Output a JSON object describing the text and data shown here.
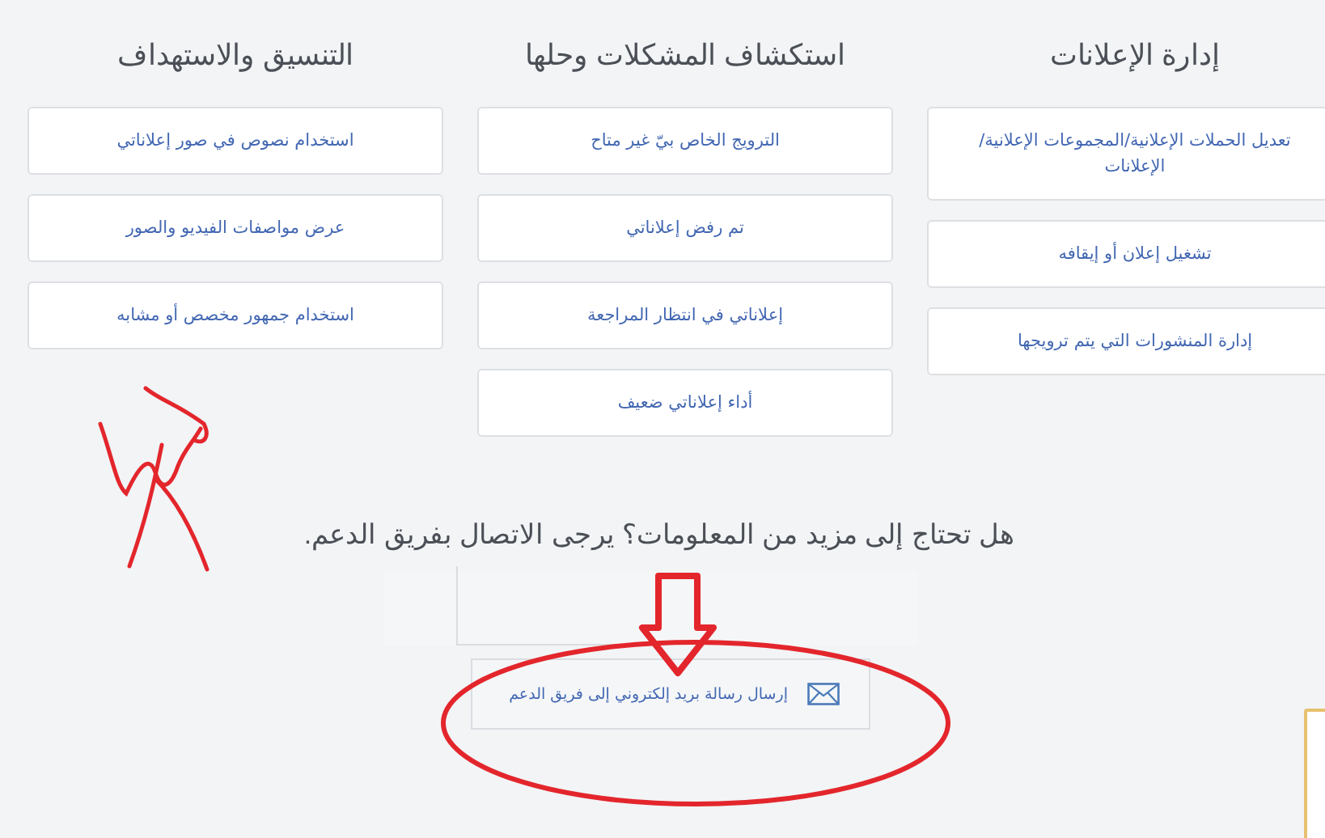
{
  "columns": [
    {
      "heading": "إدارة الإعلانات",
      "items": [
        "تعديل الحملات الإعلانية/المجموعات الإعلانية/ الإعلانات",
        "تشغيل إعلان أو إيقافه",
        "إدارة المنشورات التي يتم ترويجها"
      ]
    },
    {
      "heading": "استكشاف المشكلات وحلها",
      "items": [
        "الترويج الخاص بيّ غير متاح",
        "تم رفض إعلاناتي",
        "إعلاناتي في انتظار المراجعة",
        "أداء إعلاناتي ضعيف"
      ]
    },
    {
      "heading": "التنسيق والاستهداف",
      "items": [
        "استخدام نصوص في صور إعلاناتي",
        "عرض مواصفات الفيديو والصور",
        "استخدام جمهور مخصص أو مشابه"
      ]
    }
  ],
  "support": {
    "question": "هل تحتاج إلى مزيد من المعلومات؟ يرجى الاتصال بفريق الدعم.",
    "email_button": "إرسال رسالة بريد إلكتروني إلى فريق الدعم"
  }
}
